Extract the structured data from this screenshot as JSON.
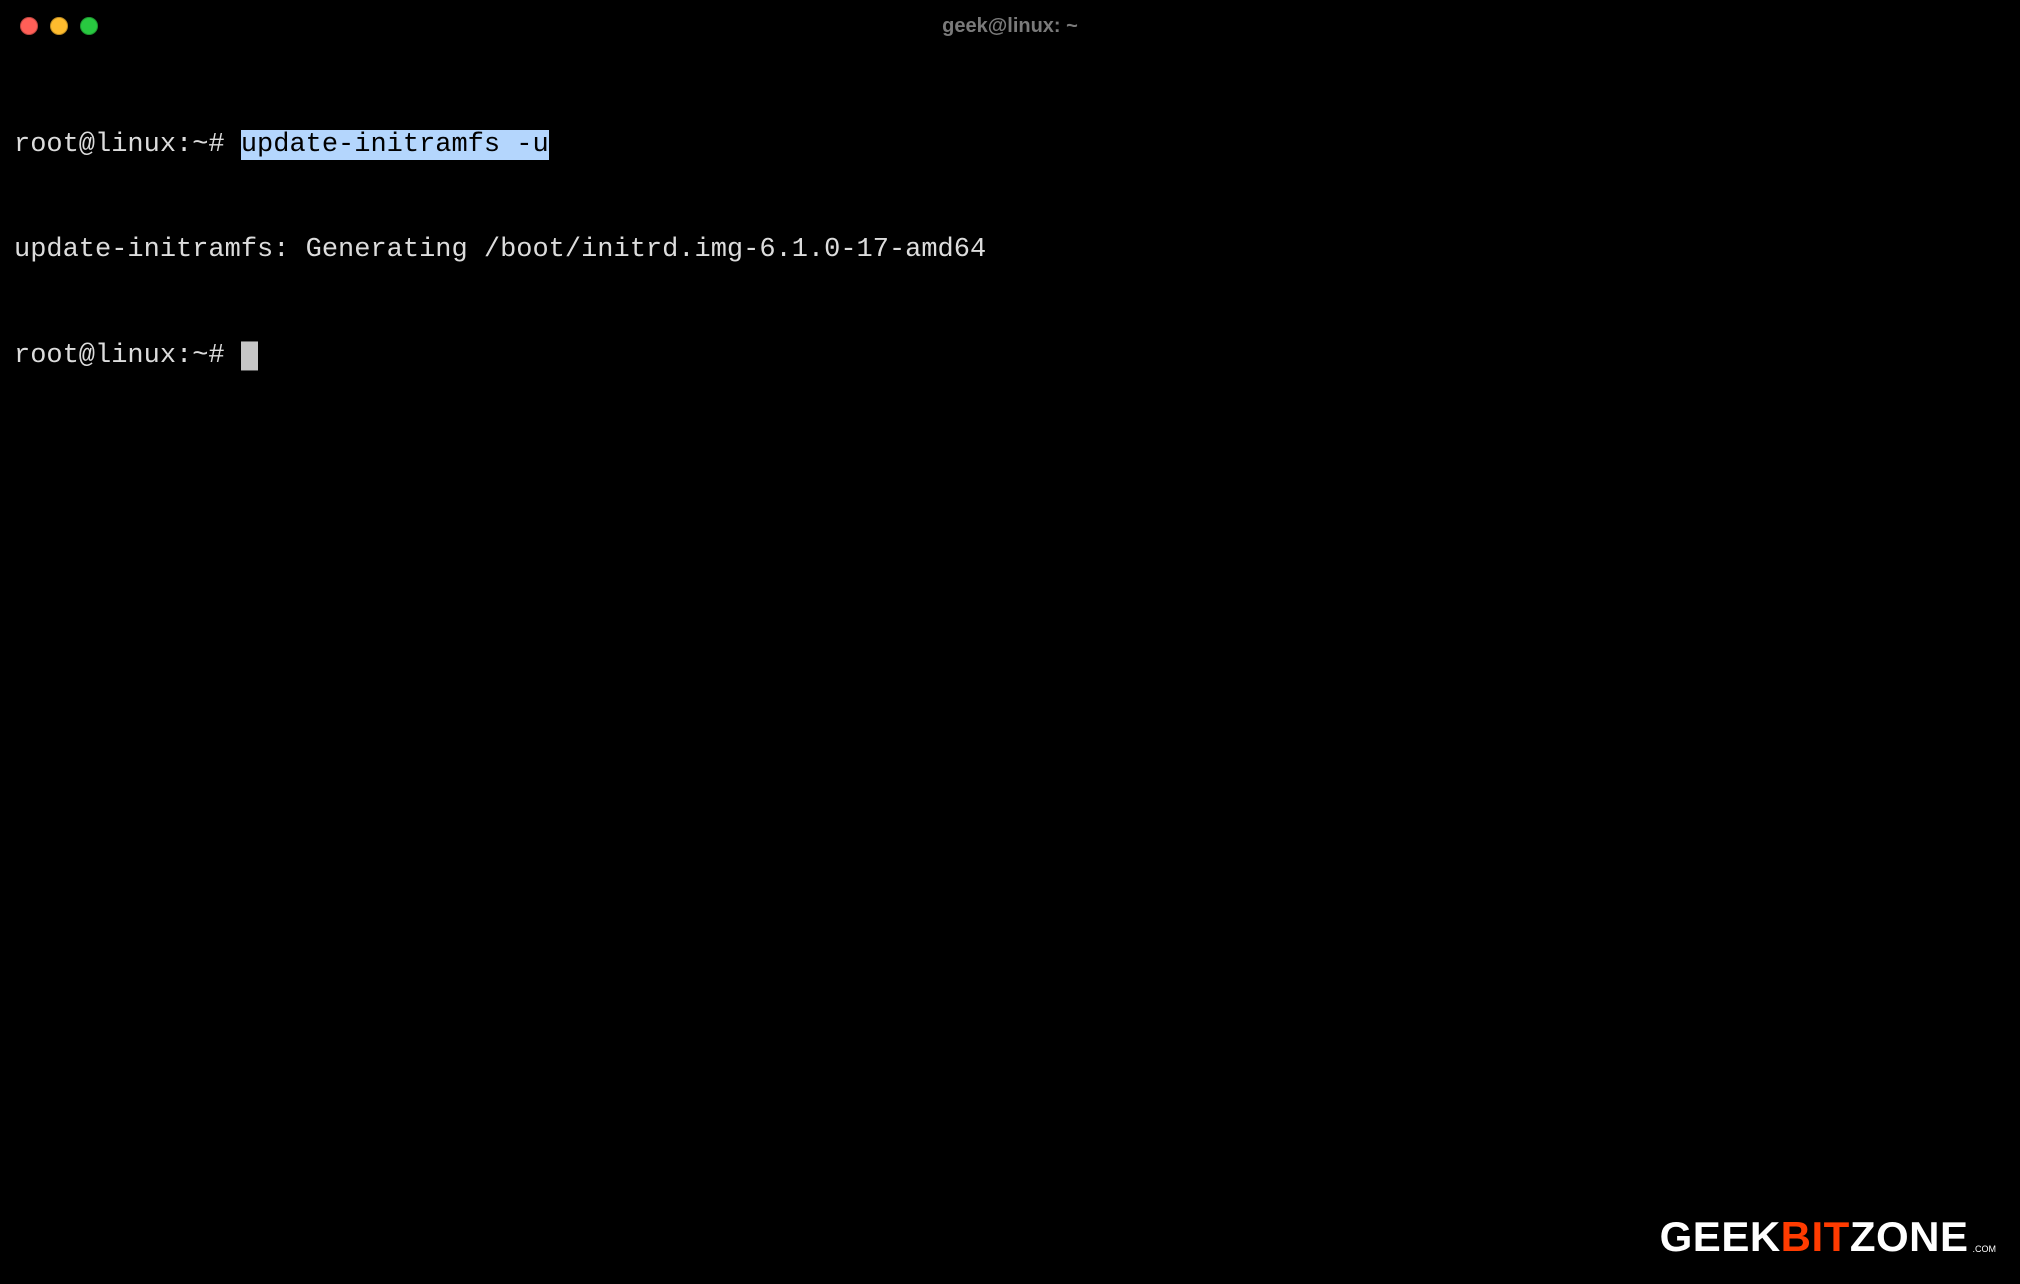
{
  "window": {
    "title": "geek@linux: ~"
  },
  "terminal": {
    "lines": [
      {
        "prompt": "root@linux:~# ",
        "command": "update-initramfs -u",
        "command_selected": true
      },
      {
        "text": "update-initramfs: Generating /boot/initrd.img-6.1.0-17-amd64"
      },
      {
        "prompt": "root@linux:~# ",
        "cursor": true
      }
    ]
  },
  "watermark": {
    "geek": "GEEK",
    "bit": "BIT",
    "zone": "ZONE",
    "com": ".COM"
  },
  "colors": {
    "selection_bg": "#b4d6fd",
    "selection_fg": "#000000",
    "text": "#dcdcdc",
    "accent": "#ff3b00"
  }
}
